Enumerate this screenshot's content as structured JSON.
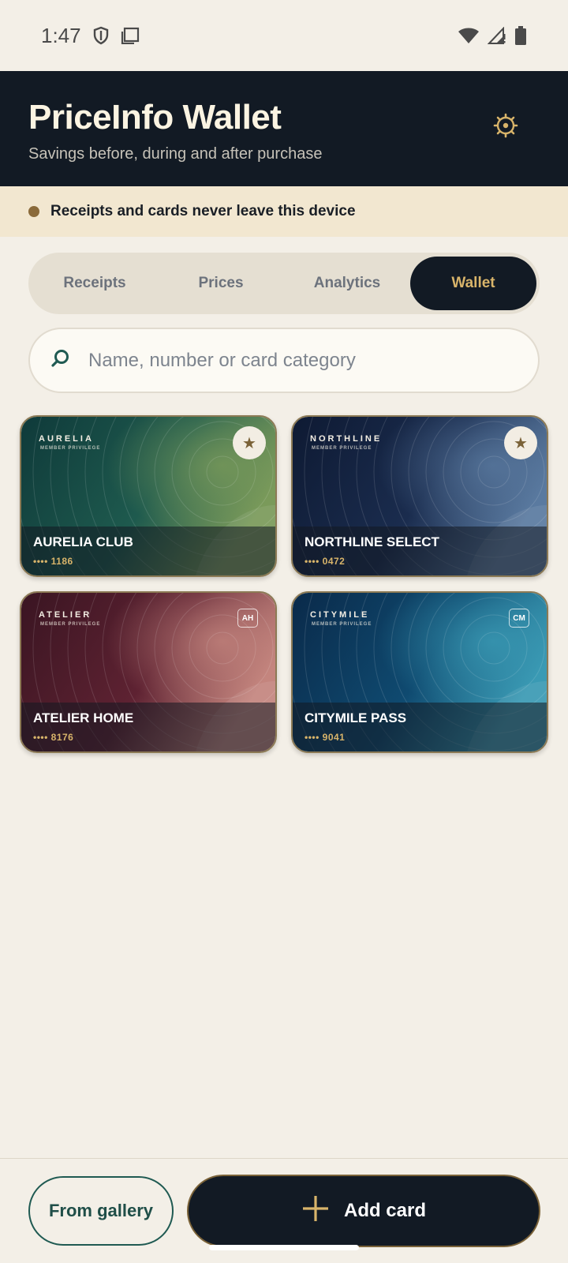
{
  "status_bar": {
    "time": "1:47",
    "icons_left": [
      "shield-icon",
      "screenshot-icon"
    ],
    "icons_right": [
      "wifi-icon",
      "signal-icon",
      "battery-icon"
    ]
  },
  "header": {
    "title": "PriceInfo Wallet",
    "subtitle": "Savings before, during and after purchase",
    "settings_icon": "gear-icon"
  },
  "banner": {
    "text": "Receipts and cards never leave this device"
  },
  "tabs": [
    {
      "label": "Receipts",
      "active": false
    },
    {
      "label": "Prices",
      "active": false
    },
    {
      "label": "Analytics",
      "active": false
    },
    {
      "label": "Wallet",
      "active": true
    }
  ],
  "search": {
    "placeholder": "Name, number or card category",
    "value": ""
  },
  "cards": [
    {
      "brand": "AURELIA",
      "privilege": "MEMBER PRIVILEGE",
      "name": "AURELIA CLUB",
      "number": "•••• 1186",
      "favorite": true,
      "initials": "",
      "colors": [
        "#0f3a3a",
        "#1e5a4e",
        "#7a9a5a"
      ]
    },
    {
      "brand": "NORTHLINE",
      "privilege": "MEMBER PRIVILEGE",
      "name": "NORTHLINE SELECT",
      "number": "•••• 0472",
      "favorite": true,
      "initials": "",
      "colors": [
        "#0e1a33",
        "#1a2c4e",
        "#5a7aa0"
      ]
    },
    {
      "brand": "ATELIER",
      "privilege": "MEMBER PRIVILEGE",
      "name": "ATELIER HOME",
      "number": "•••• 8176",
      "favorite": false,
      "initials": "AH",
      "colors": [
        "#3a1522",
        "#5e2232",
        "#c4857e"
      ]
    },
    {
      "brand": "CITYMILE",
      "privilege": "MEMBER PRIVILEGE",
      "name": "CITYMILE PASS",
      "number": "•••• 9041",
      "favorite": false,
      "initials": "CM",
      "colors": [
        "#0a2a4a",
        "#0f4a70",
        "#3a9ab4"
      ]
    }
  ],
  "bottom": {
    "gallery_label": "From gallery",
    "add_label": "Add card"
  },
  "colors": {
    "background": "#f3efe7",
    "header": "#121a24",
    "accent_gold": "#d8b46a",
    "teal": "#1f5a52"
  }
}
